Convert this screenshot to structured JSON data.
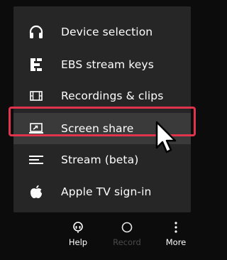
{
  "menu": {
    "items": [
      {
        "label": "Device selection",
        "icon": "headphones-icon"
      },
      {
        "label": "EBS stream keys",
        "icon": "ebs-logo-icon"
      },
      {
        "label": "Recordings & clips",
        "icon": "film-icon"
      },
      {
        "label": "Screen share",
        "icon": "screen-share-icon"
      },
      {
        "label": "Stream (beta)",
        "icon": "stream-lines-icon"
      },
      {
        "label": "Apple TV sign-in",
        "icon": "apple-icon"
      }
    ]
  },
  "bottom_bar": {
    "help_label": "Help",
    "record_label": "Record",
    "more_label": "More"
  },
  "colors": {
    "background": "#0c0c0c",
    "menu_background": "#262626",
    "highlight_background": "#3a3a3a",
    "highlight_border": "#e0344c",
    "text": "#ffffff",
    "disabled_text": "#4a4a4a"
  }
}
